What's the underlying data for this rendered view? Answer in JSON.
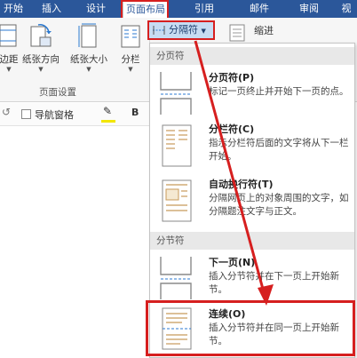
{
  "tabs": [
    {
      "label": "开始"
    },
    {
      "label": "插入"
    },
    {
      "label": "设计"
    },
    {
      "label": "页面布局"
    },
    {
      "label": "引用"
    },
    {
      "label": "邮件"
    },
    {
      "label": "审阅"
    },
    {
      "label": "视"
    }
  ],
  "ribbon": {
    "margins_label": "边距",
    "orientation_label": "纸张方向",
    "size_label": "纸张大小",
    "columns_label": "分栏",
    "group_label": "页面设置",
    "breaks_label": "分隔符",
    "indent_label": "缩进"
  },
  "doc_toolbar": {
    "nav_pane_label": "导航窗格",
    "bold_label": "B"
  },
  "menu": {
    "section_page_breaks": "分页符",
    "section_section_breaks": "分节符",
    "items": [
      {
        "title": "分页符(P)",
        "desc": "标记一页终止并开始下一页的点。"
      },
      {
        "title": "分栏符(C)",
        "desc": "指示分栏符后面的文字将从下一栏开始。"
      },
      {
        "title": "自动换行符(T)",
        "desc": "分隔网页上的对象周围的文字，如分隔题注文字与正文。"
      },
      {
        "title": "下一页(N)",
        "desc": "插入分节符并在下一页上开始新节。"
      },
      {
        "title": "连续(O)",
        "desc": "插入分节符并在同一页上开始新节。"
      }
    ]
  },
  "colors": {
    "ribbon_blue": "#2b579a",
    "highlight_red": "#d61f1f",
    "button_active": "#c7dcf2"
  }
}
